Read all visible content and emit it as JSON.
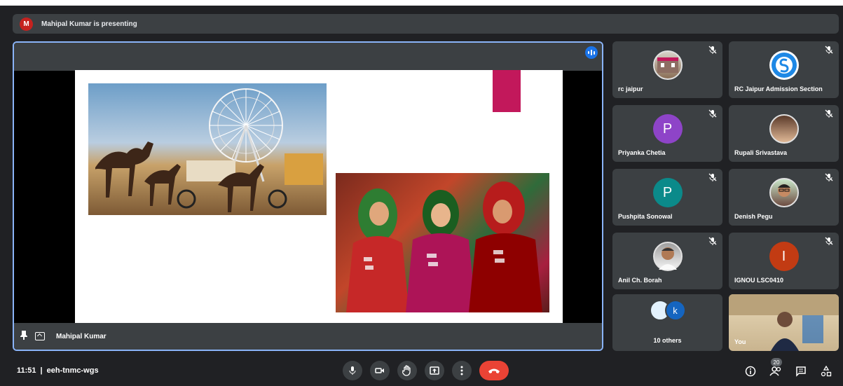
{
  "banner": {
    "avatar_letter": "M",
    "text": "Mahipal Kumar is presenting"
  },
  "presentation": {
    "presenter_name": "Mahipal Kumar",
    "accent_color": "#c2185b"
  },
  "participants": [
    {
      "name": "rc jaipur",
      "avatar": "photo",
      "muted": true
    },
    {
      "name": "RC Jaipur Admission Section",
      "avatar": "logo",
      "muted": true
    },
    {
      "name": "Priyanka Chetia",
      "avatar_letter": "P",
      "avatar_color": "#8e44c8",
      "muted": true
    },
    {
      "name": "Rupali Srivastava",
      "avatar": "photo",
      "muted": true
    },
    {
      "name": "Pushpita Sonowal",
      "avatar_letter": "P",
      "avatar_color": "#0b8a8a",
      "muted": true
    },
    {
      "name": "Denish Pegu",
      "avatar": "photo",
      "muted": true
    },
    {
      "name": "Anil Ch. Borah",
      "avatar": "photo",
      "muted": true
    },
    {
      "name": "IGNOU LSC0410",
      "avatar_letter": "I",
      "avatar_color": "#c23b13",
      "muted": true
    }
  ],
  "others": {
    "label": "10 others",
    "letter": "k"
  },
  "self": {
    "label": "You"
  },
  "bottom": {
    "time": "11:51",
    "separator": "|",
    "meeting_code": "eeh-tnmc-wgs",
    "participant_count": "20"
  }
}
